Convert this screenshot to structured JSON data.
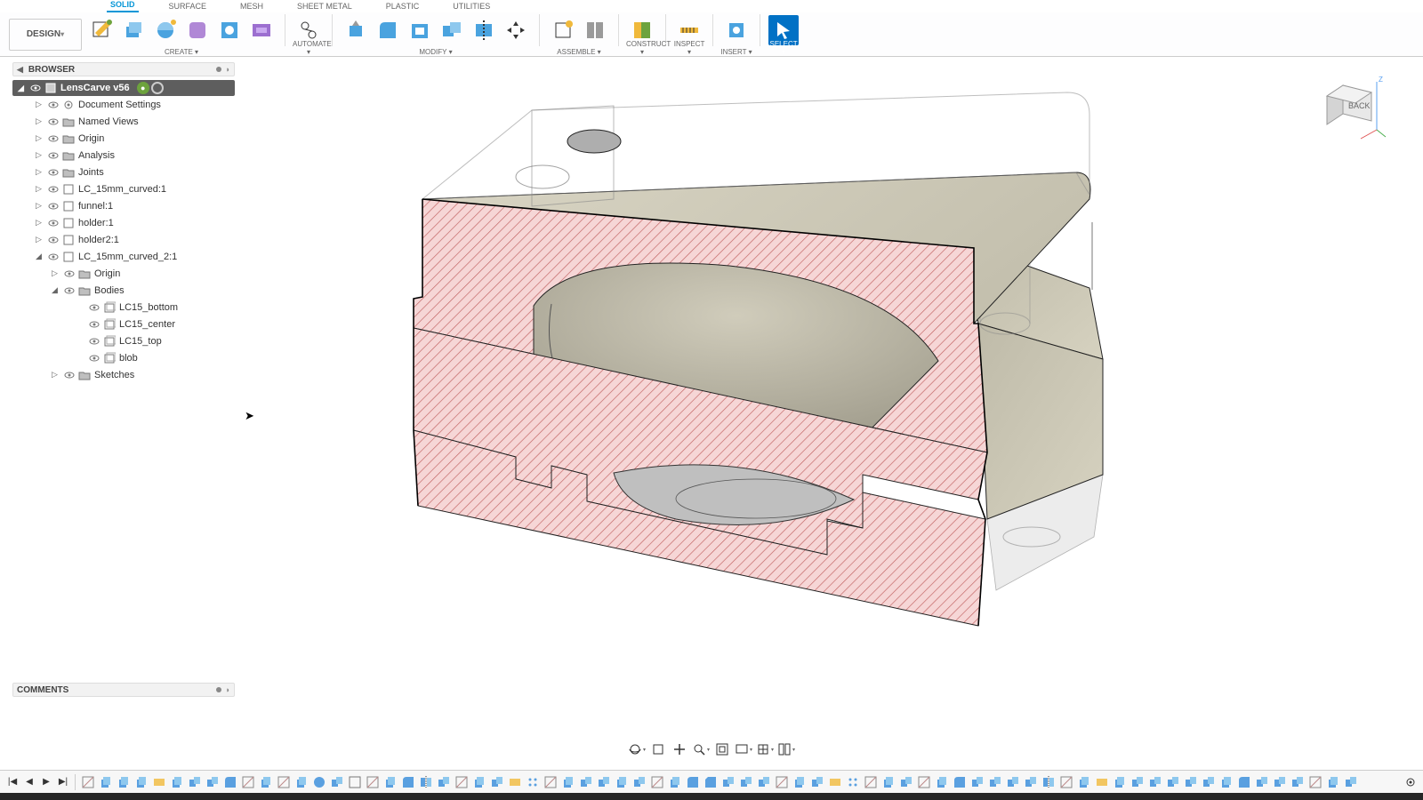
{
  "workspace": {
    "label": "DESIGN"
  },
  "tabs": [
    {
      "label": "SOLID",
      "active": true
    },
    {
      "label": "SURFACE"
    },
    {
      "label": "MESH"
    },
    {
      "label": "SHEET METAL"
    },
    {
      "label": "PLASTIC"
    },
    {
      "label": "UTILITIES"
    }
  ],
  "tool_groups": {
    "create": "CREATE",
    "automate": "AUTOMATE",
    "modify": "MODIFY",
    "assemble": "ASSEMBLE",
    "construct": "CONSTRUCT",
    "inspect": "INSPECT",
    "insert": "INSERT",
    "select": "SELECT"
  },
  "browser": {
    "title": "BROWSER",
    "root": "LensCarve v56",
    "items": [
      {
        "label": "Document Settings",
        "icon": "gear",
        "level": 1,
        "arrow": "▷"
      },
      {
        "label": "Named Views",
        "icon": "folder",
        "level": 1,
        "arrow": "▷"
      },
      {
        "label": "Origin",
        "icon": "folder",
        "level": 1,
        "arrow": "▷"
      },
      {
        "label": "Analysis",
        "icon": "folder",
        "level": 1,
        "arrow": "▷"
      },
      {
        "label": "Joints",
        "icon": "folder",
        "level": 1,
        "arrow": "▷"
      },
      {
        "label": "LC_15mm_curved:1",
        "icon": "comp",
        "level": 1,
        "arrow": "▷"
      },
      {
        "label": "funnel:1",
        "icon": "comp",
        "level": 1,
        "arrow": "▷"
      },
      {
        "label": "holder:1",
        "icon": "comp",
        "level": 1,
        "arrow": "▷"
      },
      {
        "label": "holder2:1",
        "icon": "comp",
        "level": 1,
        "arrow": "▷"
      },
      {
        "label": "LC_15mm_curved_2:1",
        "icon": "comp",
        "level": 1,
        "arrow": "◢"
      },
      {
        "label": "Origin",
        "icon": "folder",
        "level": 2,
        "arrow": "▷"
      },
      {
        "label": "Bodies",
        "icon": "folder",
        "level": 2,
        "arrow": "◢"
      },
      {
        "label": "LC15_bottom",
        "icon": "body",
        "level": 3,
        "arrow": ""
      },
      {
        "label": "LC15_center",
        "icon": "body",
        "level": 3,
        "arrow": ""
      },
      {
        "label": "LC15_top",
        "icon": "body",
        "level": 3,
        "arrow": ""
      },
      {
        "label": "blob",
        "icon": "body",
        "level": 3,
        "arrow": ""
      },
      {
        "label": "Sketches",
        "icon": "folder",
        "level": 2,
        "arrow": "▷"
      }
    ]
  },
  "comments": {
    "title": "COMMENTS"
  },
  "viewcube": {
    "face": "BACK",
    "axis": "Z"
  },
  "timeline": {
    "controls": [
      "|◀",
      "◀",
      "▶",
      "▶|"
    ],
    "item_count": 72
  }
}
